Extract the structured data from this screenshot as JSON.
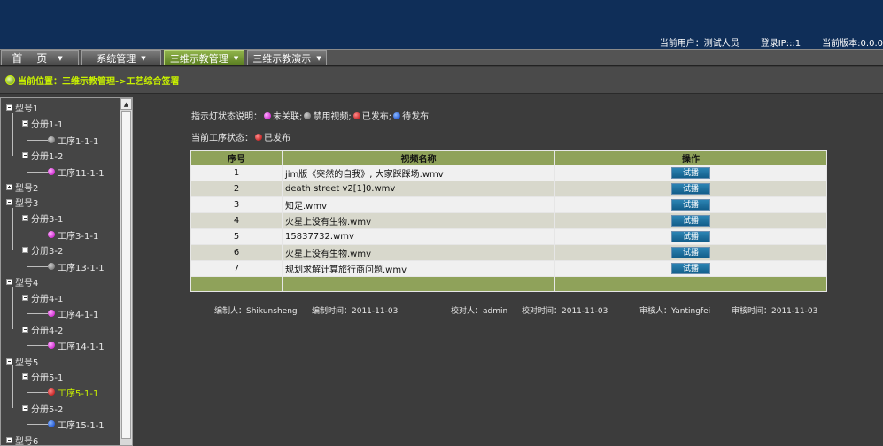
{
  "header": {
    "current_user": "当前用户：测试人员",
    "login_ip": "登录IP:::1",
    "version": "当前版本:0.0.0"
  },
  "menu": {
    "items": [
      {
        "label": "首 页"
      },
      {
        "label": "系统管理"
      },
      {
        "label": "三维示教管理"
      },
      {
        "label": "三维示教演示"
      }
    ]
  },
  "breadcrumb": {
    "text": "当前位置：三维示教管理->工艺综合签署"
  },
  "tree": {
    "nodes": [
      {
        "label": "型号1"
      },
      {
        "label": "分册1-1"
      },
      {
        "label": "工序1-1-1"
      },
      {
        "label": "分册1-2"
      },
      {
        "label": "工序11-1-1"
      },
      {
        "label": "型号2"
      },
      {
        "label": "型号3"
      },
      {
        "label": "分册3-1"
      },
      {
        "label": "工序3-1-1"
      },
      {
        "label": "分册3-2"
      },
      {
        "label": "工序13-1-1"
      },
      {
        "label": "型号4"
      },
      {
        "label": "分册4-1"
      },
      {
        "label": "工序4-1-1"
      },
      {
        "label": "分册4-2"
      },
      {
        "label": "工序14-1-1"
      },
      {
        "label": "型号5"
      },
      {
        "label": "分册5-1"
      },
      {
        "label": "工序5-1-1"
      },
      {
        "label": "分册5-2"
      },
      {
        "label": "工序15-1-1"
      },
      {
        "label": "型号6"
      }
    ]
  },
  "legend": {
    "prefix": "指示灯状态说明：",
    "items": [
      {
        "label": "未关联;",
        "color": "#c000c0"
      },
      {
        "label": "禁用视频;",
        "color": "#606060"
      },
      {
        "label": "已发布;",
        "color": "#b00000"
      },
      {
        "label": "待发布",
        "color": "#0036c0"
      }
    ]
  },
  "current_status": {
    "prefix": "当前工序状态：",
    "label": "已发布",
    "color": "#b00000"
  },
  "table": {
    "headers": [
      "序号",
      "视频名称",
      "操作"
    ],
    "play_label": "试播",
    "rows": [
      {
        "seq": "1",
        "name": "jim版《突然的自我》, 大家踩踩场.wmv"
      },
      {
        "seq": "2",
        "name": "death street v2[1]0.wmv"
      },
      {
        "seq": "3",
        "name": "知足.wmv"
      },
      {
        "seq": "4",
        "name": "火星上没有生物.wmv"
      },
      {
        "seq": "5",
        "name": "15837732.wmv"
      },
      {
        "seq": "6",
        "name": "火星上没有生物.wmv"
      },
      {
        "seq": "7",
        "name": "规划求解计算旅行商问题.wmv"
      }
    ]
  },
  "meta": {
    "compiler": "编制人：Shikunsheng",
    "compile_time": "编制时间：2011-11-03",
    "proofreader": "校对人：admin",
    "proof_time": "校对时间：2011-11-03",
    "reviewer": "审核人：Yantingfei",
    "review_time": "审核时间：2011-11-03"
  }
}
